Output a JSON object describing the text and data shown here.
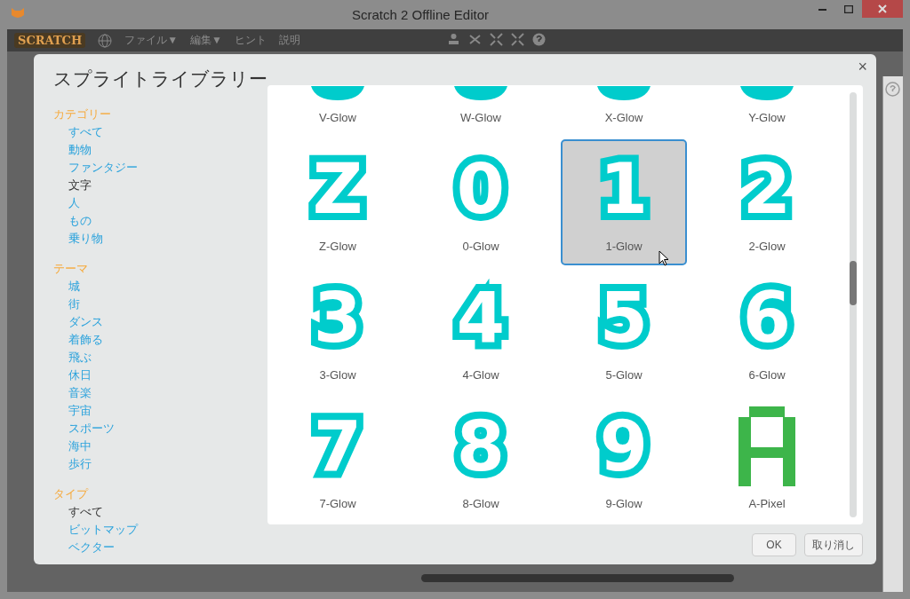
{
  "window": {
    "title": "Scratch 2 Offline Editor"
  },
  "menu_bar": {
    "logo": "SCRATCH",
    "items": [
      "ファイル▼",
      "編集▼",
      "ヒント",
      "説明"
    ]
  },
  "dialog": {
    "title": "スプライトライブラリー",
    "close": "×",
    "sections": [
      {
        "header": "カテゴリー",
        "items": [
          {
            "label": "すべて",
            "selected": false
          },
          {
            "label": "動物",
            "selected": false
          },
          {
            "label": "ファンタジー",
            "selected": false
          },
          {
            "label": "文字",
            "selected": true
          },
          {
            "label": "人",
            "selected": false
          },
          {
            "label": "もの",
            "selected": false
          },
          {
            "label": "乗り物",
            "selected": false
          }
        ]
      },
      {
        "header": "テーマ",
        "items": [
          {
            "label": "城",
            "selected": false
          },
          {
            "label": "街",
            "selected": false
          },
          {
            "label": "ダンス",
            "selected": false
          },
          {
            "label": "着飾る",
            "selected": false
          },
          {
            "label": "飛ぶ",
            "selected": false
          },
          {
            "label": "休日",
            "selected": false
          },
          {
            "label": "音楽",
            "selected": false
          },
          {
            "label": "宇宙",
            "selected": false
          },
          {
            "label": "スポーツ",
            "selected": false
          },
          {
            "label": "海中",
            "selected": false
          },
          {
            "label": "歩行",
            "selected": false
          }
        ]
      },
      {
        "header": "タイプ",
        "items": [
          {
            "label": "すべて",
            "selected": true
          },
          {
            "label": "ビットマップ",
            "selected": false
          },
          {
            "label": "ベクター",
            "selected": false
          }
        ]
      }
    ],
    "sprites": [
      {
        "label": "V-Glow",
        "kind": "cut",
        "selected": false
      },
      {
        "label": "W-Glow",
        "kind": "cut",
        "selected": false
      },
      {
        "label": "X-Glow",
        "kind": "cut",
        "selected": false
      },
      {
        "label": "Y-Glow",
        "kind": "cut",
        "selected": false
      },
      {
        "label": "Z-Glow",
        "kind": "glow",
        "glyph": "Z",
        "selected": false
      },
      {
        "label": "0-Glow",
        "kind": "glow",
        "glyph": "0",
        "selected": false
      },
      {
        "label": "1-Glow",
        "kind": "glow",
        "glyph": "1",
        "selected": true
      },
      {
        "label": "2-Glow",
        "kind": "glow",
        "glyph": "2",
        "selected": false
      },
      {
        "label": "3-Glow",
        "kind": "glow",
        "glyph": "3",
        "selected": false
      },
      {
        "label": "4-Glow",
        "kind": "glow",
        "glyph": "4",
        "selected": false
      },
      {
        "label": "5-Glow",
        "kind": "glow",
        "glyph": "5",
        "selected": false
      },
      {
        "label": "6-Glow",
        "kind": "glow",
        "glyph": "6",
        "selected": false
      },
      {
        "label": "7-Glow",
        "kind": "glow",
        "glyph": "7",
        "selected": false
      },
      {
        "label": "8-Glow",
        "kind": "glow",
        "glyph": "8",
        "selected": false
      },
      {
        "label": "9-Glow",
        "kind": "glow",
        "glyph": "9",
        "selected": false
      },
      {
        "label": "A-Pixel",
        "kind": "pixel",
        "selected": false
      }
    ],
    "buttons": [
      "OK",
      "取り消し"
    ]
  }
}
